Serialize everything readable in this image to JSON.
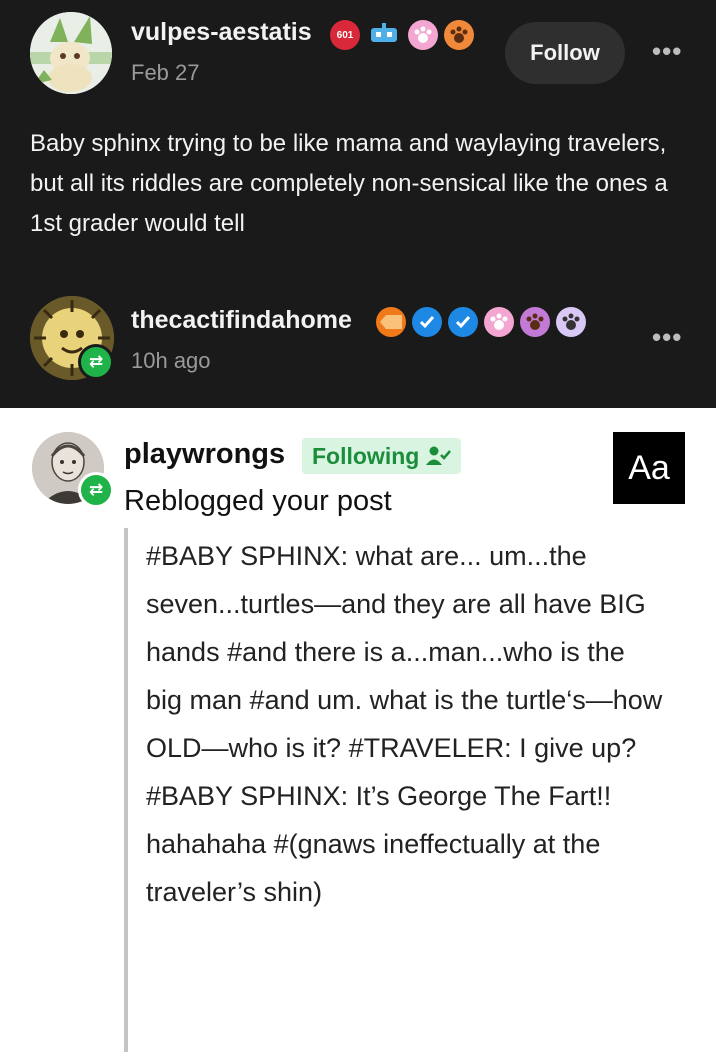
{
  "post_original": {
    "username": "vulpes-aestatis",
    "date": "Feb 27",
    "follow_label": "Follow",
    "more_label": "•••",
    "badge_icons": [
      "shield-badge-icon",
      "robot-badge-icon",
      "paw-pink-badge-icon",
      "paw-orange-badge-icon"
    ],
    "badge_text": "601",
    "body": "Baby sphinx trying to be like mama and waylaying travelers, but all its riddles are completely non-sensical like the ones a 1st grader would tell"
  },
  "reblog_header": {
    "username": "thecactifindahome",
    "time": "10h ago",
    "more_label": "•••",
    "badge_icons": [
      "orange-tag-badge-icon",
      "blue-check-badge-icon",
      "blue-check-badge-icon",
      "paw-pink-badge-icon",
      "paw-orange-badge-icon",
      "paw-lilac-badge-icon"
    ]
  },
  "activity": {
    "username": "playwrongs",
    "following_label": "Following",
    "action": "Reblogged your post",
    "aa_label": "Aa",
    "quote": "#BABY SPHINX: what are... um...the seven...turtles—and they are all have BIG hands #and there is a...man...who is the big man #and um. what is the turtle‘s—how OLD—who is it? #TRAVELER: I give up? #BABY SPHINX: It’s George The Fart!! hahahaha #(gnaws ineffectually at the traveler’s shin)"
  },
  "colors": {
    "dark_bg": "#1a1a1a",
    "follow_btn_bg": "#2f2f2f",
    "reblog_green": "#1fb34a",
    "following_chip_bg": "#d9f4e1",
    "following_chip_text": "#1b8d3b"
  }
}
